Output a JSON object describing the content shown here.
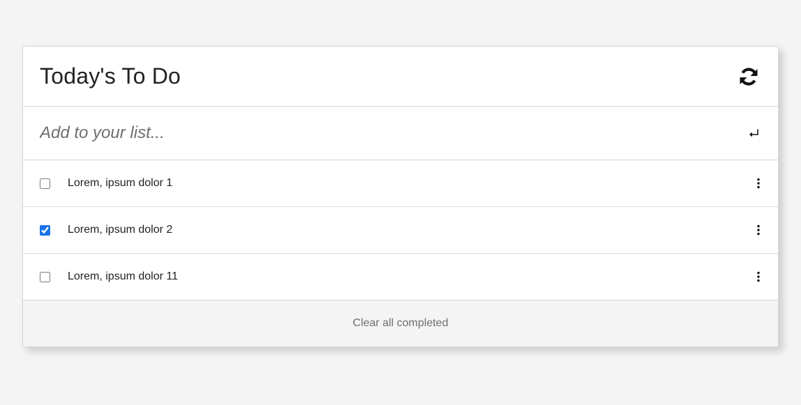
{
  "header": {
    "title": "Today's To Do",
    "refresh_icon": "refresh-icon"
  },
  "add": {
    "placeholder": "Add to your list...",
    "submit_icon": "enter-icon"
  },
  "items": [
    {
      "label": "Lorem, ipsum dolor 1",
      "checked": false
    },
    {
      "label": "Lorem, ipsum dolor 2",
      "checked": true
    },
    {
      "label": "Lorem, ipsum dolor 11",
      "checked": false
    }
  ],
  "footer": {
    "clear_label": "Clear all completed"
  },
  "colors": {
    "background": "#f4f4f4",
    "card": "#ffffff",
    "accent": "#1a73e8",
    "muted_text": "#6e6e6e"
  }
}
